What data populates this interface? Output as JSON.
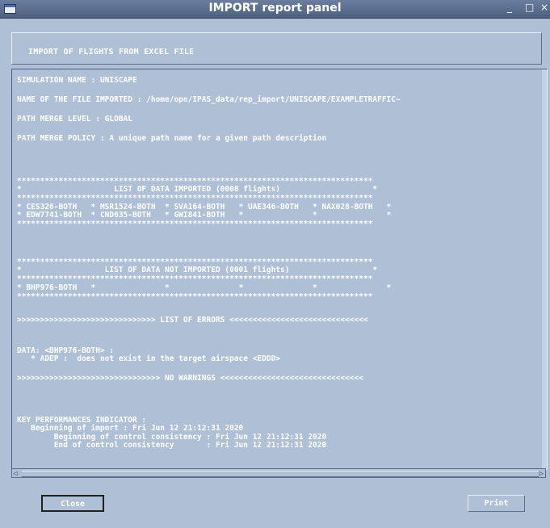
{
  "window": {
    "title": "IMPORT report panel",
    "minimize_label": "_",
    "maximize_label": "□",
    "close_label": "×"
  },
  "header": {
    "text": "IMPORT OF FLIGHTS FROM EXCEL FILE"
  },
  "report": {
    "lines": [
      "SIMULATION NAME : UNISCAPE",
      "NAME OF THE FILE IMPORTED : /home/ope/IPAS_data/rep_import/UNISCAPE/EXAMPLETRAFFIC~",
      "PATH MERGE LEVEL : GLOBAL",
      "PATH MERGE POLICY : A unique path name for a given path description",
      "*****************************************************************************",
      "*                    LIST OF DATA IMPORTED (0008 flights)                    *",
      "*****************************************************************************",
      "* CES326-BOTH   * MSR1524-BOTH  * SVA164-BOTH   * UAE346-BOTH   * NAX028-BOTH   *",
      "* EDW7741-BOTH  * CND635-BOTH   * GWI841-BOTH   *               *               *",
      "*****************************************************************************",
      "*****************************************************************************",
      "*                  LIST OF DATA NOT IMPORTED (0001 flights)                  *",
      "*****************************************************************************",
      "* BHP976-BOTH   *               *               *               *               *",
      "*****************************************************************************",
      ">>>>>>>>>>>>>>>>>>>>>>>>>>>>>> LIST OF ERRORS <<<<<<<<<<<<<<<<<<<<<<<<<<<<<<",
      "DATA: <BHP976-BOTH> :",
      "   * ADEP :  does not exist in the target airspace <EDDD>",
      ">>>>>>>>>>>>>>>>>>>>>>>>>>>>>>> NO WARNINGS <<<<<<<<<<<<<<<<<<<<<<<<<<<<<<<",
      "KEY PERFORMANCES INDICATOR :",
      "   Beginning of import : Fri Jun 12 21:12:31 2020",
      "        Beginning of control consistency : Fri Jun 12 21:12:31 2020",
      "        End of control consistency       : Fri Jun 12 21:12:31 2020"
    ]
  },
  "buttons": {
    "close_label": "Close",
    "print_label": "Print"
  },
  "scrollbar": {
    "left_arrow": "◁",
    "right_arrow": "▷"
  }
}
